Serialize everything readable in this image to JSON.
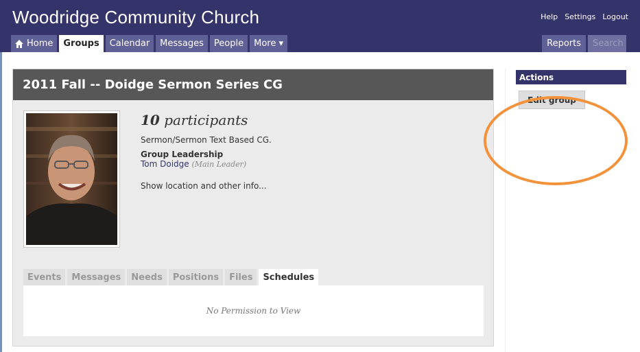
{
  "header": {
    "site_title": "Woodridge Community Church",
    "utility_links": [
      "Help",
      "Settings",
      "Logout"
    ],
    "nav_tabs": [
      {
        "label": "Home",
        "icon": "home-icon"
      },
      {
        "label": "Groups",
        "active": true
      },
      {
        "label": "Calendar"
      },
      {
        "label": "Messages"
      },
      {
        "label": "People"
      },
      {
        "label": "More ▾"
      }
    ],
    "right_tabs": [
      "Reports",
      "Search"
    ]
  },
  "group": {
    "title": "2011 Fall -- Doidge Sermon Series CG",
    "participant_count": "10",
    "participant_label": " participants",
    "description": "Sermon/Sermon Text Based CG.",
    "leadership_heading": "Group Leadership",
    "leader_name": "Tom Doidge",
    "leader_role": "(Main Leader)",
    "show_location": "Show location and other info..."
  },
  "subtabs": [
    "Events",
    "Messages",
    "Needs",
    "Positions",
    "Files",
    "Schedules"
  ],
  "active_subtab": "Schedules",
  "tab_panel": {
    "message": "No Permission to View"
  },
  "sidebar": {
    "actions_heading": "Actions",
    "edit_button_label": "Edit group"
  },
  "colors": {
    "header_bg": "#34336a",
    "tab_bg": "#5f6095",
    "title_bar_bg": "#575757",
    "highlight": "#f4923b"
  }
}
